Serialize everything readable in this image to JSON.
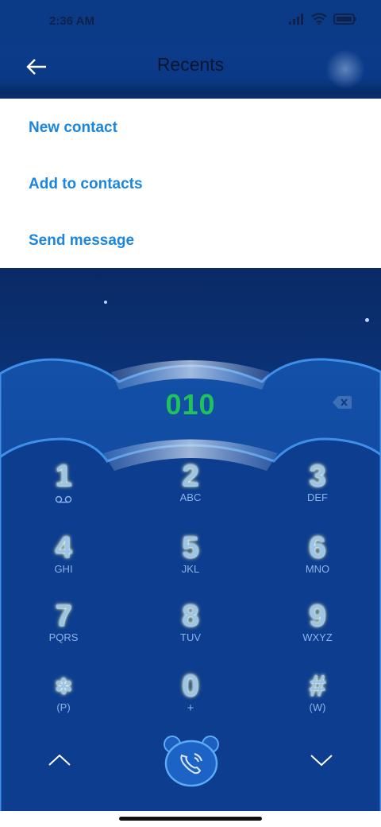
{
  "status_bar": {
    "time": "2:36 AM"
  },
  "header": {
    "title": "Recents"
  },
  "menu": {
    "items": [
      {
        "label": "New contact"
      },
      {
        "label": "Add to contacts"
      },
      {
        "label": "Send message"
      }
    ]
  },
  "dialer": {
    "number": "010",
    "keys": [
      {
        "digit": "1",
        "letters": ""
      },
      {
        "digit": "2",
        "letters": "ABC"
      },
      {
        "digit": "3",
        "letters": "DEF"
      },
      {
        "digit": "4",
        "letters": "GHI"
      },
      {
        "digit": "5",
        "letters": "JKL"
      },
      {
        "digit": "6",
        "letters": "MNO"
      },
      {
        "digit": "7",
        "letters": "PQRS"
      },
      {
        "digit": "8",
        "letters": "TUV"
      },
      {
        "digit": "9",
        "letters": "WXYZ"
      },
      {
        "digit": "✻",
        "letters": "(P)"
      },
      {
        "digit": "0",
        "letters": "+"
      },
      {
        "digit": "#",
        "letters": "(W)"
      }
    ]
  },
  "icons": {
    "back": "back-arrow-icon",
    "backspace": "backspace-icon",
    "voicemail": "voicemail-icon",
    "call": "bear-phone-call-icon",
    "up": "chevron-up-icon",
    "down": "chevron-down-icon"
  },
  "colors": {
    "accent": "#1a86e0",
    "number": "#1fc35a",
    "background": "#0b3a8a"
  }
}
